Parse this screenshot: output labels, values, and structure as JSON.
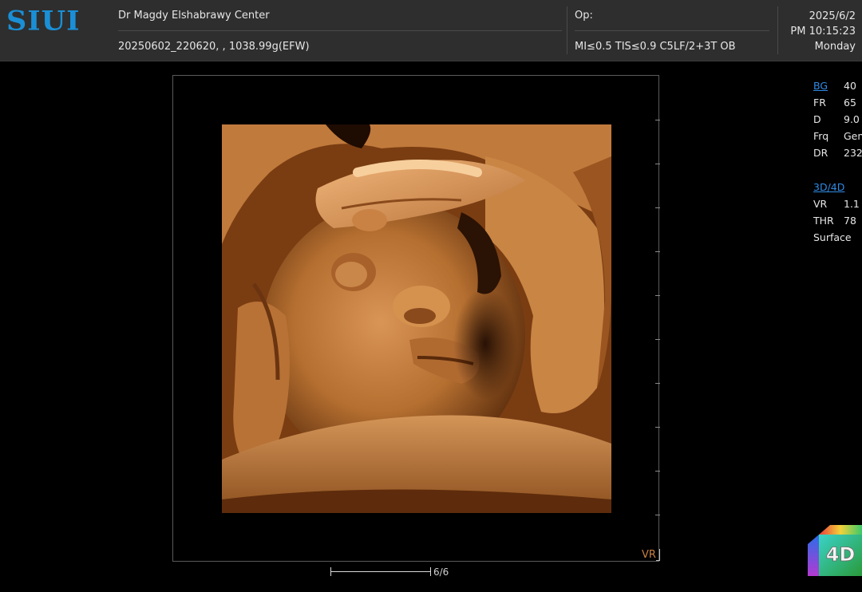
{
  "header": {
    "logo": "SIUI",
    "center_name": "Dr Magdy Elshabrawy Center",
    "study_info": "20250602_220620,  , 1038.99g(EFW)",
    "operator_label": "Op:",
    "acoustic_info": "MI≤0.5  TIS≤0.9    C5LF/2+3T OB",
    "date": "2025/6/2",
    "time": "PM 10:15:23",
    "weekday": "Monday"
  },
  "params": {
    "bmode": [
      {
        "key": "BG",
        "value": "40",
        "link": true
      },
      {
        "key": "FR",
        "value": "65"
      },
      {
        "key": "D",
        "value": "9.0"
      },
      {
        "key": "Frq",
        "value": "Gen"
      },
      {
        "key": "DR",
        "value": "232"
      }
    ],
    "volume": [
      {
        "key": "3D/4D",
        "value": "",
        "link": true
      },
      {
        "key": "VR",
        "value": "1.1"
      },
      {
        "key": "THR",
        "value": "78"
      },
      {
        "key": "Surface",
        "value": ""
      }
    ]
  },
  "viewport": {
    "mode_label": "VR",
    "frame_counter": "6/6"
  },
  "badge": {
    "label": "4D"
  },
  "colors": {
    "header_bg": "#2e2e2e",
    "logo_blue": "#1a8fd6",
    "link_blue": "#2f8be6",
    "render_amber": "#c9833f"
  }
}
